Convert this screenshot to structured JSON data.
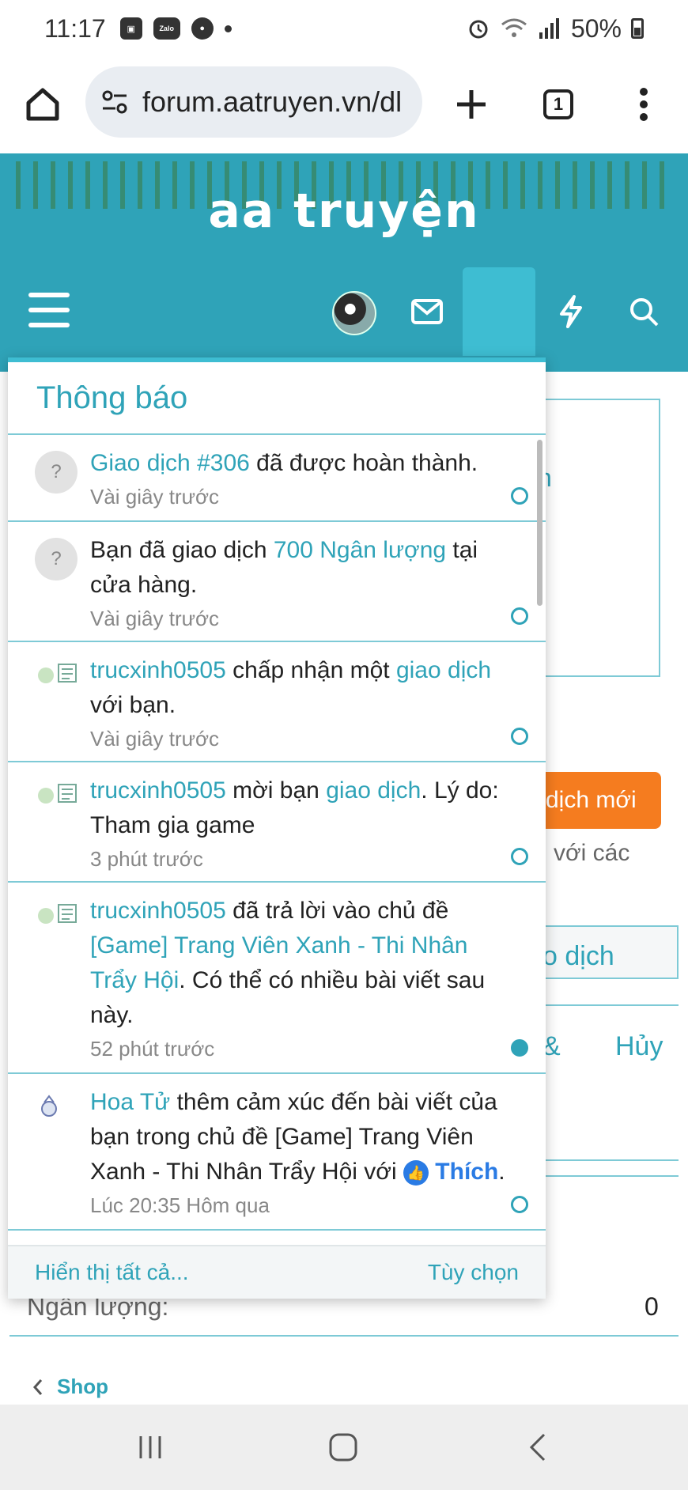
{
  "status_bar": {
    "time": "11:17",
    "zalo": "Zalo",
    "battery": "50%"
  },
  "browser": {
    "url": "forum.aatruyen.vn/dl",
    "tab_count": "1"
  },
  "site": {
    "logo": "aa truyện"
  },
  "background": {
    "partial_n": "n",
    "btn_new": "dịch mới",
    "text_voi_cac": "với các",
    "text_o_dich": "o dịch",
    "text_amp": "&",
    "text_huy": "Hủy",
    "ngan_luong_label": "Ngân lượng:",
    "ngan_luong_value": "0",
    "breadcrumb_shop": "Shop"
  },
  "notifications": {
    "title": "Thông báo",
    "items": [
      {
        "link1": "Giao dịch #306",
        "text1": " đã được hoàn thành.",
        "time": "Vài giây trước"
      },
      {
        "text0": "Bạn đã giao dịch ",
        "link1": "700 Ngân lượng",
        "text1": " tại cửa hàng.",
        "time": "Vài giây trước"
      },
      {
        "user": "trucxinh0505",
        "text1": " chấp nhận một ",
        "link1": "giao dịch",
        "text2": " với bạn.",
        "time": "Vài giây trước"
      },
      {
        "user": "trucxinh0505",
        "text1": " mời bạn ",
        "link1": "giao dịch",
        "text2": ". Lý do: Tham gia game",
        "time": "3 phút trước"
      },
      {
        "user": "trucxinh0505",
        "text1": " đã trả lời vào chủ đề ",
        "link1": "[Game] Trang Viên Xanh - Thi Nhân Trẩy Hội",
        "text2": ". Có thể có nhiều bài viết sau này.",
        "time": "52 phút trước"
      },
      {
        "user": "Hoa Tử",
        "text1": " thêm cảm xúc đến bài viết của bạn trong chủ đề [Game] Trang Viên Xanh - Thi Nhân Trẩy Hội với ",
        "reaction": "Thích",
        "text2": ".",
        "time": "Lúc 20:35 Hôm qua"
      }
    ],
    "footer_show_all": "Hiển thị tất cả...",
    "footer_options": "Tùy chọn"
  },
  "colors": {
    "accent": "#2fa3b8",
    "header_bg": "#2fa3b8",
    "button_orange": "#f57c1f",
    "like_blue": "#2a7be4"
  }
}
